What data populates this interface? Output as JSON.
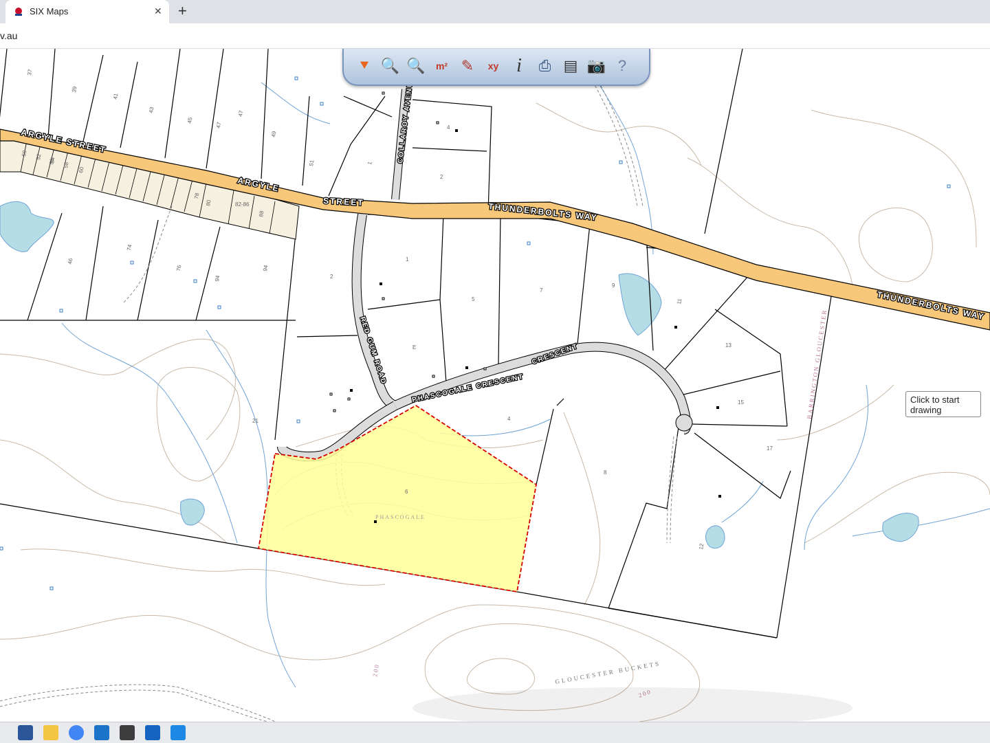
{
  "browser": {
    "tab_title": "SIX Maps",
    "tab_close": "✕",
    "new_tab": "+",
    "url": "v.au"
  },
  "toolbar": {
    "tools": [
      {
        "name": "nsw-logo-icon",
        "glyph": "⯆"
      },
      {
        "name": "zoom-in-icon",
        "glyph": "🔍"
      },
      {
        "name": "zoom-out-icon",
        "glyph": "🔍"
      },
      {
        "name": "measure-area-icon",
        "glyph": "m²"
      },
      {
        "name": "measure-distance-icon",
        "glyph": "✎"
      },
      {
        "name": "coordinates-icon",
        "glyph": "xy"
      },
      {
        "name": "info-icon",
        "glyph": "i"
      },
      {
        "name": "search-icon",
        "glyph": "⎙"
      },
      {
        "name": "print-icon",
        "glyph": "▤"
      },
      {
        "name": "camera-icon",
        "glyph": "📷"
      },
      {
        "name": "help-icon",
        "glyph": "?"
      }
    ]
  },
  "tooltip": "Click to start drawing",
  "map": {
    "roads": {
      "argyle_street_1": "ARGYLE STREET",
      "argyle_street_2": "ARGYLE",
      "street": "STREET",
      "thunderbolts_1": "THUNDERBOLTS WAY",
      "thunderbolts_2": "THUNDERBOLTS WAY",
      "collaroy": "COLLAROY AVENUE",
      "red_gum": "RED GUM ROAD",
      "phascogale": "PHASCOGALE CRESCENT",
      "crescent": "CRESCENT"
    },
    "labels": {
      "phascogale_area": "PHASCOGALE",
      "gloucester_buckets": "GLOUCESTER BUCKETS",
      "barrington_gloucester": "BARRINGTON GLOUCESTER",
      "contour_200": "200",
      "contour_200b": "200"
    },
    "lot_numbers": [
      "37",
      "39",
      "41",
      "43",
      "45",
      "47",
      "47",
      "49",
      "51",
      "1",
      "4",
      "2",
      "1",
      "2",
      "5",
      "7",
      "9",
      "11",
      "13",
      "15",
      "17",
      "12",
      "8",
      "4",
      "21",
      "46",
      "74",
      "76",
      "94",
      "94",
      "E",
      "6",
      "82-86",
      "88",
      "78",
      "80",
      "56",
      "58",
      "60",
      "52",
      "54",
      "50"
    ]
  },
  "taskbar": {
    "icons": [
      "word-icon",
      "explorer-icon",
      "chrome-icon",
      "mail-icon",
      "store-icon",
      "app-icon",
      "photos-icon"
    ]
  }
}
